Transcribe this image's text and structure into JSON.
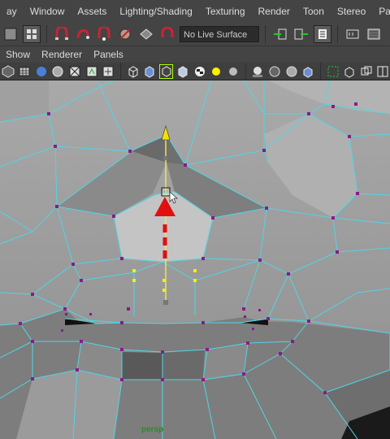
{
  "menu": [
    "ay",
    "Window",
    "Assets",
    "Lighting/Shading",
    "Texturing",
    "Render",
    "Toon",
    "Stereo",
    "Paint Effects"
  ],
  "shelf": {
    "live_surface": "No Live Surface",
    "icons_left": [
      "select-tool-icon",
      "paint-select-icon",
      "snap-grid-icon",
      "snap-curve-icon",
      "snap-point-icon",
      "snap-view-icon",
      "make-live-icon"
    ],
    "icons_right": [
      "input-ops-icon",
      "output-ops-icon",
      "construction-history-icon",
      "render-frame-icon",
      "render-settings-icon"
    ]
  },
  "panel_menu": [
    "Show",
    "Renderer",
    "Panels"
  ],
  "panel_icons": [
    "wireframe-icon",
    "smooth-shade-icon",
    "flat-shade-icon",
    "bounding-box-icon",
    "points-icon",
    "bookmark-icon",
    "xray-icon",
    "textured-icon",
    "use-lights-icon",
    "shadows-icon",
    "backface-icon",
    "isolate-icon",
    "grid-icon",
    "camera-icon",
    "frame-icon"
  ],
  "viewport": {
    "camera_label": "persp"
  },
  "colors": {
    "wire": "#4fd6e6",
    "vertex": "#8a1a8a",
    "selected": "#f2f200",
    "manip": "#e01010"
  }
}
